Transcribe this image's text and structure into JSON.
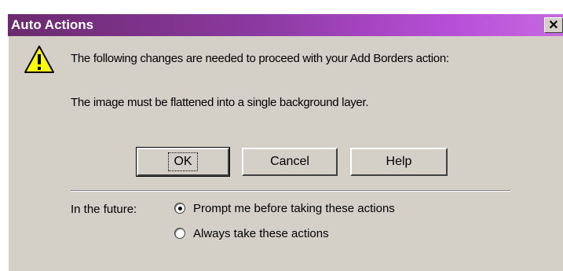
{
  "window": {
    "title": "Auto Actions",
    "close_glyph": "✕",
    "title_colors": [
      "#6b2a6e",
      "#c56ae0"
    ]
  },
  "dialog": {
    "icon": "warning-icon",
    "message_line1": "The following changes are needed to proceed with your Add Borders action:",
    "message_line2": "The image must be flattened into a single background layer."
  },
  "buttons": {
    "ok": "OK",
    "cancel": "Cancel",
    "help": "Help"
  },
  "future": {
    "label": "In the future:",
    "options": [
      {
        "label": "Prompt me before taking these actions",
        "selected": true
      },
      {
        "label": "Always take these actions",
        "selected": false
      }
    ]
  }
}
